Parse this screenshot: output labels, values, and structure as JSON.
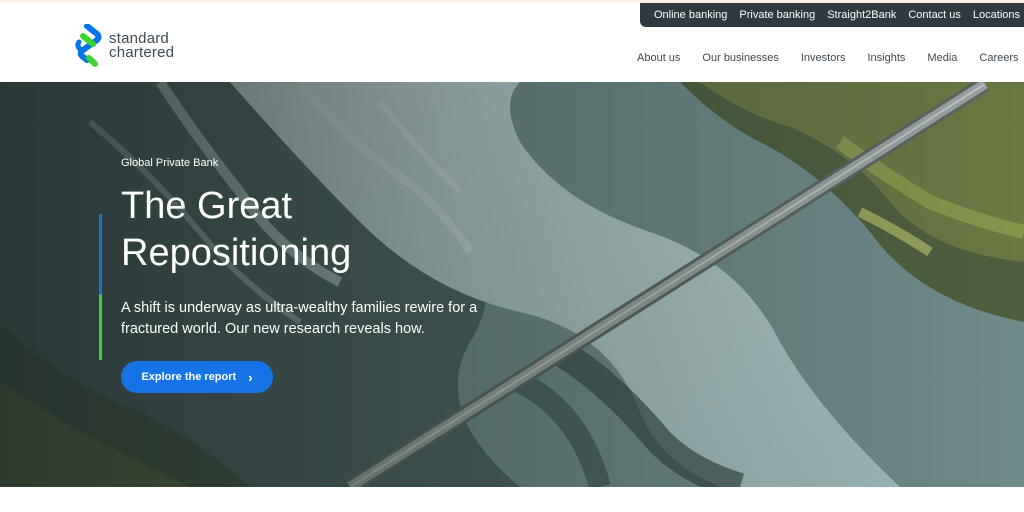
{
  "brand": {
    "line1": "standard",
    "line2": "chartered"
  },
  "utility_nav": [
    "Online banking",
    "Private banking",
    "Straight2Bank",
    "Contact us",
    "Locations"
  ],
  "main_nav": [
    "About us",
    "Our businesses",
    "Investors",
    "Insights",
    "Media",
    "Careers"
  ],
  "icons": {
    "search": "search-icon",
    "cta": "chevron-right-icon",
    "logo": "standard-chartered-logo"
  },
  "colors": {
    "accent_blue": "#1673e6",
    "accent_green": "#38d430",
    "utility_bar": "#2f3a40"
  },
  "hero": {
    "eyebrow": "Global Private Bank",
    "title_line1": "The Great",
    "title_line2": "Repositioning",
    "description": "A shift is underway as ultra-wealthy families rewire for a fractured world. Our new research reveals how.",
    "cta_label": "Explore the report"
  }
}
